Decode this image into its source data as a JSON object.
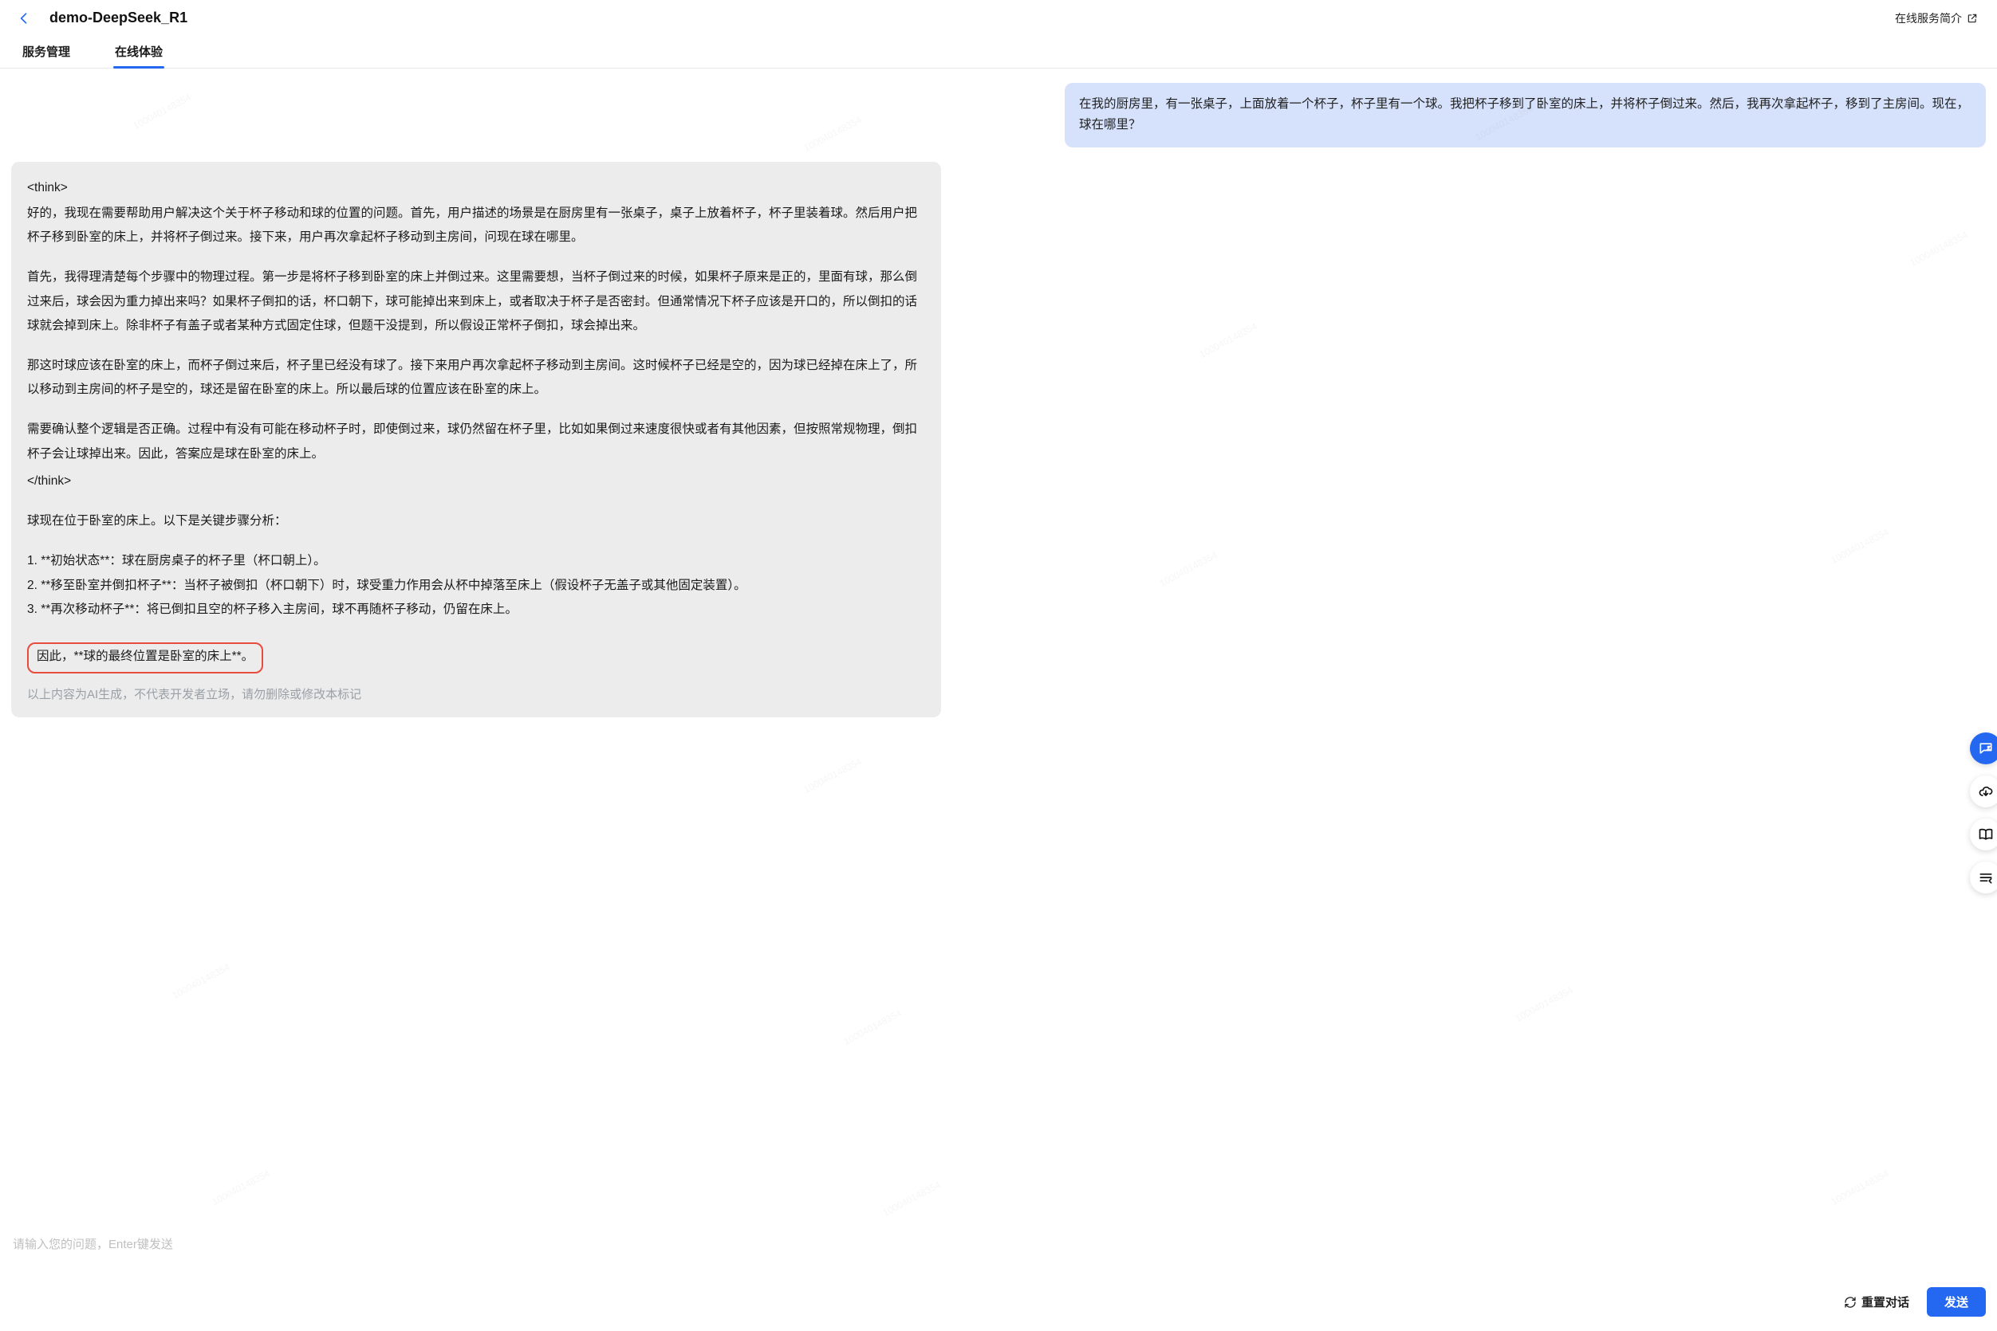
{
  "header": {
    "title": "demo-DeepSeek_R1",
    "link_label": "在线服务简介"
  },
  "tabs": {
    "items": [
      {
        "label": "服务管理",
        "active": false
      },
      {
        "label": "在线体验",
        "active": true
      }
    ]
  },
  "watermark": "100040148354",
  "user_message": "在我的厨房里，有一张桌子，上面放着一个杯子，杯子里有一个球。我把杯子移到了卧室的床上，并将杯子倒过来。然后，我再次拿起杯子，移到了主房间。现在，球在哪里？",
  "assistant_message": {
    "think_open": "<think>",
    "p1": "好的，我现在需要帮助用户解决这个关于杯子移动和球的位置的问题。首先，用户描述的场景是在厨房里有一张桌子，桌子上放着杯子，杯子里装着球。然后用户把杯子移到卧室的床上，并将杯子倒过来。接下来，用户再次拿起杯子移动到主房间，问现在球在哪里。",
    "p2": "首先，我得理清楚每个步骤中的物理过程。第一步是将杯子移到卧室的床上并倒过来。这里需要想，当杯子倒过来的时候，如果杯子原来是正的，里面有球，那么倒过来后，球会因为重力掉出来吗？如果杯子倒扣的话，杯口朝下，球可能掉出来到床上，或者取决于杯子是否密封。但通常情况下杯子应该是开口的，所以倒扣的话球就会掉到床上。除非杯子有盖子或者某种方式固定住球，但题干没提到，所以假设正常杯子倒扣，球会掉出来。",
    "p3": "那这时球应该在卧室的床上，而杯子倒过来后，杯子里已经没有球了。接下来用户再次拿起杯子移动到主房间。这时候杯子已经是空的，因为球已经掉在床上了，所以移动到主房间的杯子是空的，球还是留在卧室的床上。所以最后球的位置应该在卧室的床上。",
    "p4": "需要确认整个逻辑是否正确。过程中有没有可能在移动杯子时，即使倒过来，球仍然留在杯子里，比如如果倒过来速度很快或者有其他因素，但按照常规物理，倒扣杯子会让球掉出来。因此，答案应是球在卧室的床上。",
    "think_close": "</think>",
    "answer_intro": "球现在位于卧室的床上。以下是关键步骤分析：",
    "steps": [
      "1. **初始状态**：球在厨房桌子的杯子里（杯口朝上）。",
      "2. **移至卧室并倒扣杯子**：当杯子被倒扣（杯口朝下）时，球受重力作用会从杯中掉落至床上（假设杯子无盖子或其他固定装置）。",
      "3. **再次移动杯子**：将已倒扣且空的杯子移入主房间，球不再随杯子移动，仍留在床上。"
    ],
    "conclusion": "因此，**球的最终位置是卧室的床上**。",
    "disclaimer": "以上内容为AI生成，不代表开发者立场，请勿删除或修改本标记"
  },
  "footer": {
    "input_placeholder": "请输入您的问题，Enter键发送",
    "reset_label": "重置对话",
    "send_label": "发送"
  },
  "float_buttons": [
    {
      "name": "support-chat-icon"
    },
    {
      "name": "cloud-icon"
    },
    {
      "name": "book-icon"
    },
    {
      "name": "menu-collapse-icon"
    }
  ]
}
